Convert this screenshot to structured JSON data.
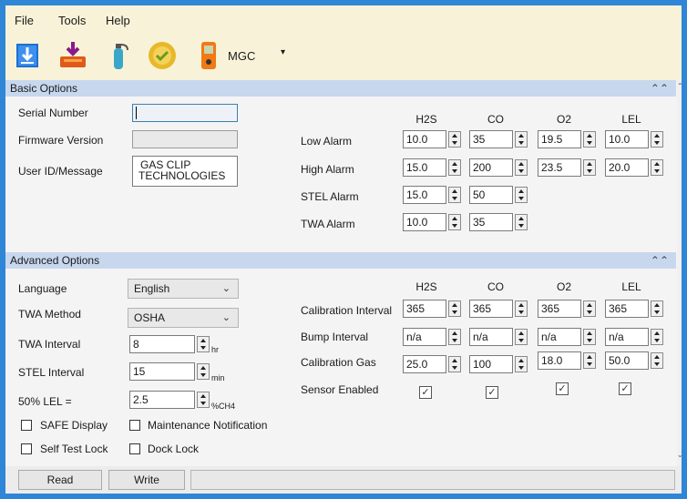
{
  "menu": {
    "file": "File",
    "tools": "Tools",
    "help": "Help"
  },
  "toolbar": {
    "device_label": "MGC"
  },
  "basic": {
    "header": "Basic Options",
    "serial_label": "Serial Number",
    "serial_value": "",
    "firmware_label": "Firmware Version",
    "firmware_value": "",
    "userid_label": "User ID/Message",
    "userid_line1": "GAS CLIP",
    "userid_line2": "TECHNOLOGIES",
    "cols": [
      "H2S",
      "CO",
      "O2",
      "LEL"
    ],
    "rows": [
      {
        "label": "Low Alarm",
        "values": [
          "10.0",
          "35",
          "19.5",
          "10.0"
        ]
      },
      {
        "label": "High Alarm",
        "values": [
          "15.0",
          "200",
          "23.5",
          "20.0"
        ]
      },
      {
        "label": "STEL Alarm",
        "values": [
          "15.0",
          "50"
        ]
      },
      {
        "label": "TWA Alarm",
        "values": [
          "10.0",
          "35"
        ]
      }
    ]
  },
  "advanced": {
    "header": "Advanced Options",
    "language_label": "Language",
    "language_value": "English",
    "twa_method_label": "TWA Method",
    "twa_method_value": "OSHA",
    "twa_interval_label": "TWA Interval",
    "twa_interval_value": "8",
    "twa_interval_unit": "hr",
    "stel_interval_label": "STEL Interval",
    "stel_interval_value": "15",
    "stel_interval_unit": "min",
    "lel_label": "50% LEL =",
    "lel_value": "2.5",
    "lel_unit": "%CH4",
    "safe_display": "SAFE Display",
    "maintenance": "Maintenance Notification",
    "self_test": "Self Test Lock",
    "dock_lock": "Dock Lock",
    "cols": [
      "H2S",
      "CO",
      "O2",
      "LEL"
    ],
    "cal_interval_label": "Calibration Interval",
    "cal_interval": [
      "365",
      "365",
      "365",
      "365"
    ],
    "bump_label": "Bump Interval",
    "bump": [
      "n/a",
      "n/a",
      "n/a",
      "n/a"
    ],
    "cal_gas_label": "Calibration Gas",
    "cal_gas": [
      "25.0",
      "100",
      "18.0",
      "50.0"
    ],
    "sensor_enabled_label": "Sensor Enabled"
  },
  "footer": {
    "read": "Read",
    "write": "Write"
  }
}
